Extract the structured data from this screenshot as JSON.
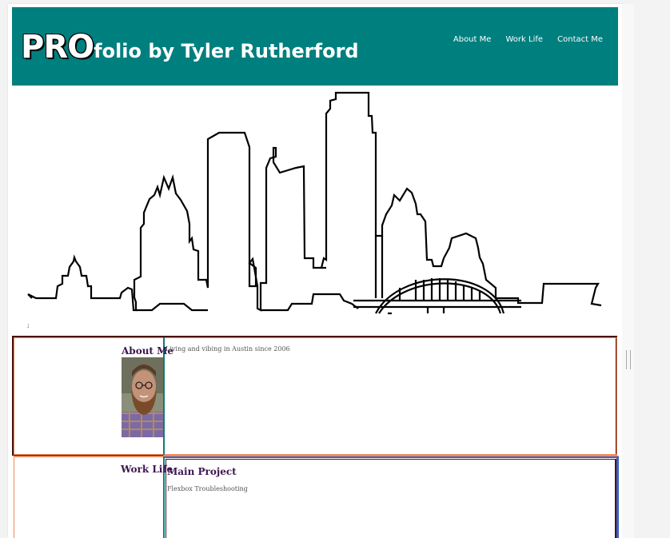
{
  "header": {
    "brand_bold": "PRO",
    "brand_rest": "folio by Tyler Rutherford"
  },
  "nav": {
    "items": [
      "About Me",
      "Work Life",
      "Contact Me"
    ]
  },
  "hero": {
    "image": "austin-skyline-outline",
    "stray_char": ";"
  },
  "about": {
    "title": "About Me",
    "text": "Living and vibing in Austin since 2006",
    "photo": "profile-photo"
  },
  "work": {
    "title": "Work Life",
    "project_title": "Main Project",
    "project_text": "Flexbox Troubleshooting"
  },
  "colors": {
    "header": "#007f7f",
    "heading": "#3d1551",
    "border_dark": "#4a1010",
    "border_orange": "#ef8a5a",
    "border_teal": "#0c7b7b",
    "border_blue": "#3a5fc8"
  }
}
